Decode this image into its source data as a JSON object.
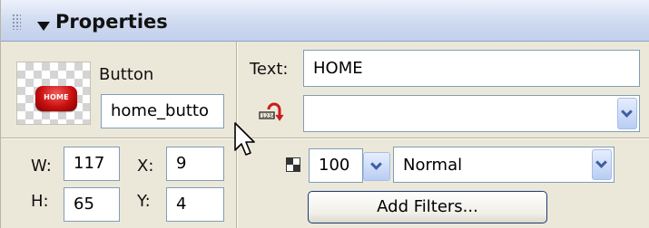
{
  "panel": {
    "title": "Properties",
    "collapse_icon": "triangle-down-icon"
  },
  "symbol": {
    "type_label": "Button",
    "instance_name": "home_butto",
    "preview_text": "HOME"
  },
  "dimensions": {
    "w_label": "W:",
    "w_value": "117",
    "h_label": "H:",
    "h_value": "65",
    "x_label": "X:",
    "x_value": "9",
    "y_label": "Y:",
    "y_value": "4"
  },
  "text_row": {
    "label": "Text:",
    "value": "HOME"
  },
  "swap_row": {
    "icon": "swap-symbol-icon",
    "value": ""
  },
  "display": {
    "alpha_icon": "alpha-checker-icon",
    "alpha_value": "100",
    "blend_mode": "Normal"
  },
  "filters": {
    "button_label": "Add Filters..."
  },
  "colors": {
    "panel_bg": "#ece8d9",
    "title_gradient_top": "#ecf1fb",
    "title_gradient_bottom": "#c2d0ec",
    "field_border": "#7f9db9",
    "combo_arrow": "#3e5f9e",
    "preview_red": "#c90f0f"
  }
}
